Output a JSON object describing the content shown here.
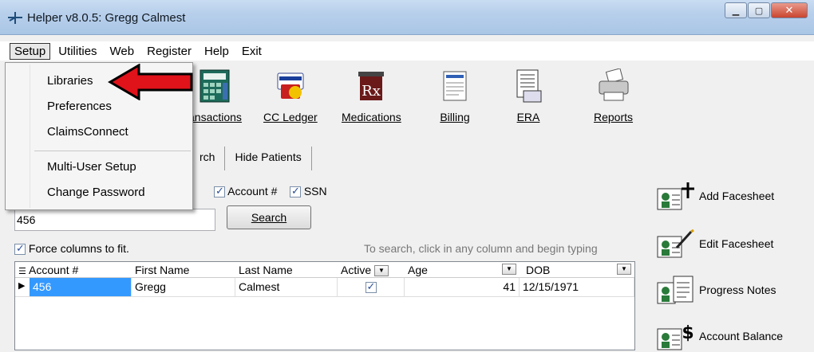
{
  "window": {
    "title": "Helper v8.0.5: Gregg Calmest",
    "controls": [
      "minimize",
      "maximize",
      "close"
    ]
  },
  "menubar": {
    "items": [
      "Setup",
      "Utilities",
      "Web",
      "Register",
      "Help",
      "Exit"
    ],
    "active": "Setup"
  },
  "setup_menu": {
    "items": [
      "Libraries",
      "Preferences",
      "ClaimsConnect",
      "Multi-User Setup",
      "Change Password"
    ],
    "highlighted": "Libraries"
  },
  "toolbar": {
    "items": [
      {
        "label": "ansactions",
        "icon": "transactions-icon"
      },
      {
        "label": "CC Ledger",
        "icon": "credit-card-icon"
      },
      {
        "label": "Medications",
        "icon": "rx-icon"
      },
      {
        "label": "Billing",
        "icon": "billing-icon"
      },
      {
        "label": "ERA",
        "icon": "era-icon"
      },
      {
        "label": "Reports",
        "icon": "printer-icon"
      }
    ]
  },
  "tabs": {
    "items": [
      "rch",
      "Hide Patients"
    ]
  },
  "search": {
    "options": {
      "account_label": "Account #",
      "account_checked": true,
      "ssn_label": "SSN",
      "ssn_checked": true
    },
    "value": "456",
    "button_label": "Search",
    "force_columns_label": "Force columns to fit.",
    "force_columns_checked": true,
    "hint": "To search, click in any column and begin typing"
  },
  "grid": {
    "columns": [
      "Account #",
      "First Name",
      "Last Name",
      "Active",
      "Age",
      "DOB"
    ],
    "rows": [
      {
        "account": "456",
        "first": "Gregg",
        "last": "Calmest",
        "active": true,
        "age": "41",
        "dob": "12/15/1971"
      }
    ]
  },
  "side_actions": {
    "items": [
      {
        "label": "Add Facesheet",
        "icon": "add-facesheet-icon"
      },
      {
        "label": "Edit Facesheet",
        "icon": "edit-facesheet-icon"
      },
      {
        "label": "Progress Notes",
        "icon": "progress-notes-icon"
      },
      {
        "label": "Account Balance",
        "icon": "account-balance-icon"
      }
    ]
  },
  "colors": {
    "accent_arrow": "#e0121a",
    "selection": "#3399ff",
    "titlebar": "#b7cfeb"
  }
}
